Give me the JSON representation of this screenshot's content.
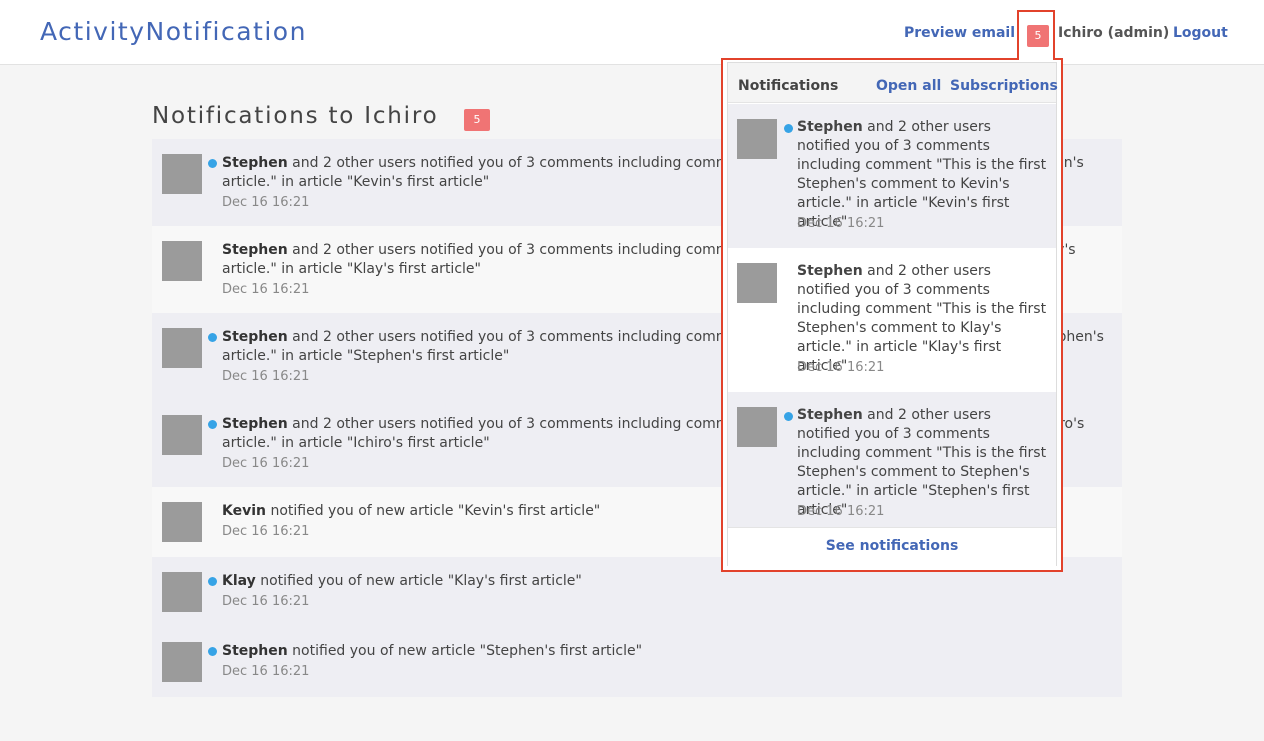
{
  "header": {
    "brand": "ActivityNotification",
    "preview_email": "Preview email",
    "badge_count": "5",
    "user": "Ichiro (admin)",
    "logout": "Logout"
  },
  "page": {
    "title": "Notifications to Ichiro",
    "badge_count": "5"
  },
  "notifications": [
    {
      "actor": "Stephen",
      "text": " and 2 other users notified you of 3 comments including comment \"This is the first Stephen's comment to Kevin's article.\" in article \"Kevin's first article\"",
      "time": "Dec 16 16:21",
      "unread": true
    },
    {
      "actor": "Stephen",
      "text": " and 2 other users notified you of 3 comments including comment \"This is the first Stephen's comment to Klay's article.\" in article \"Klay's first article\"",
      "time": "Dec 16 16:21",
      "unread": false
    },
    {
      "actor": "Stephen",
      "text": " and 2 other users notified you of 3 comments including comment \"This is the first Stephen's comment to Stephen's article.\" in article \"Stephen's first article\"",
      "time": "Dec 16 16:21",
      "unread": true
    },
    {
      "actor": "Stephen",
      "text": " and 2 other users notified you of 3 comments including comment \"This is the first Stephen's comment to Ichiro's article.\" in article \"Ichiro's first article\"",
      "time": "Dec 16 16:21",
      "unread": true
    },
    {
      "actor": "Kevin",
      "text": " notified you of new article \"Kevin's first article\"",
      "time": "Dec 16 16:21",
      "unread": false
    },
    {
      "actor": "Klay",
      "text": " notified you of new article \"Klay's first article\"",
      "time": "Dec 16 16:21",
      "unread": true
    },
    {
      "actor": "Stephen",
      "text": " notified you of new article \"Stephen's first article\"",
      "time": "Dec 16 16:21",
      "unread": true
    }
  ],
  "dropdown": {
    "title": "Notifications",
    "open_all": "Open all",
    "subscriptions": "Subscriptions",
    "see_notifications": "See notifications",
    "items": [
      {
        "actor": "Stephen",
        "text": " and 2 other users notified you of 3 comments including comment \"This is the first Stephen's comment to Kevin's article.\" in article \"Kevin's first article\"",
        "time": "Dec 16 16:21",
        "unread": true
      },
      {
        "actor": "Stephen",
        "text": " and 2 other users notified you of 3 comments including comment \"This is the first Stephen's comment to Klay's article.\" in article \"Klay's first article\"",
        "time": "Dec 16 16:21",
        "unread": false
      },
      {
        "actor": "Stephen",
        "text": " and 2 other users notified you of 3 comments including comment \"This is the first Stephen's comment to Stephen's article.\" in article \"Stephen's first article\"",
        "time": "Dec 16 16:21",
        "unread": true
      }
    ]
  },
  "colors": {
    "brand": "#4367b6",
    "badge": "#f07474",
    "unread_dot": "#36a3e6",
    "highlight_border": "#e2422b"
  }
}
